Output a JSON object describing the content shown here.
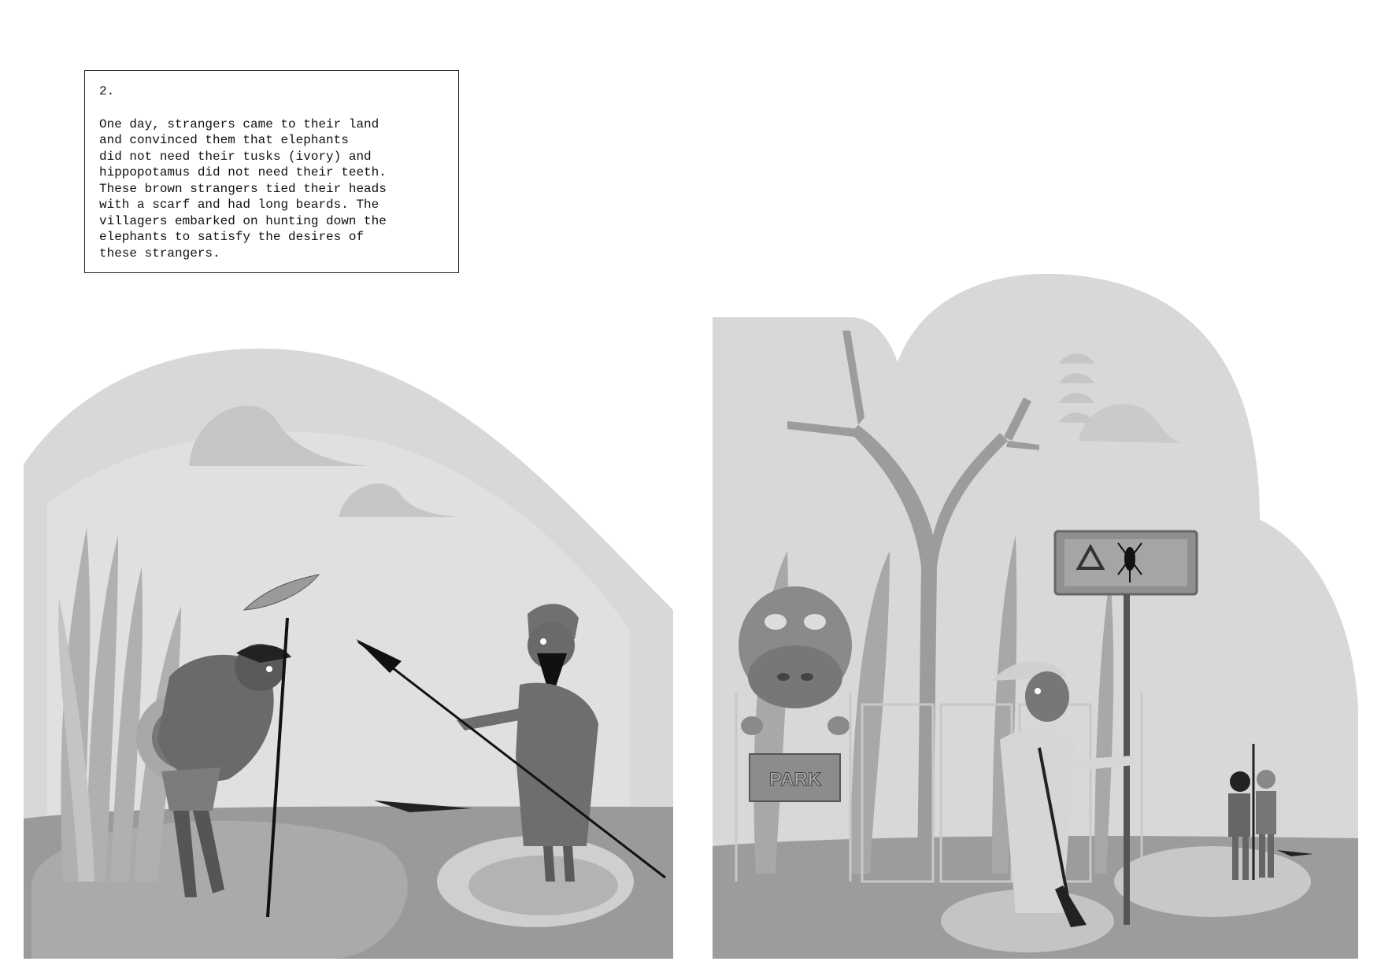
{
  "caption": {
    "number": "2.",
    "text": "One day, strangers came to their land\nand convinced them that elephants\ndid not need their tusks (ivory) and\nhippopotamus did not need their teeth.\nThese brown strangers tied their heads\nwith a scarf and had long beards. The\nvillagers embarked on hunting down the\nelephants to satisfy the desires of\nthese strangers."
  },
  "right_panel": {
    "park_sign": "PARK",
    "warning_sign_icons": [
      "warning-triangle-icon",
      "mosquito-icon"
    ]
  },
  "colors": {
    "sky": "#d6d6d6",
    "ground": "#9a9a9a",
    "figure_dark": "#5e5e5e",
    "grass": "#b5b5b5"
  }
}
